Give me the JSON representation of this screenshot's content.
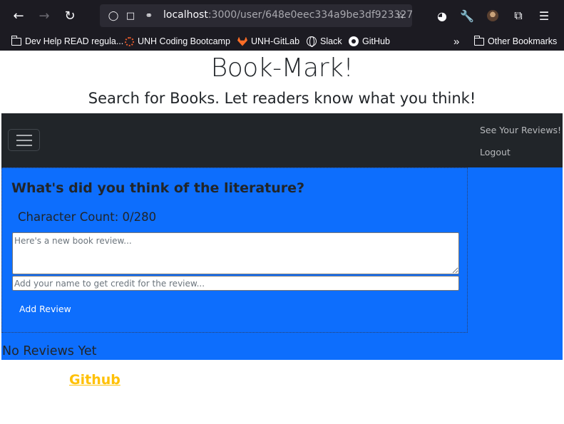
{
  "browser": {
    "url_host": "localhost",
    "url_path": ":3000/user/648e0eec334a9be3df923327",
    "bookmarks": [
      {
        "label": "Dev Help READ regula..."
      },
      {
        "label": "UNH Coding Bootcamp"
      },
      {
        "label": "UNH-GitLab"
      },
      {
        "label": "Slack"
      },
      {
        "label": "GitHub"
      }
    ],
    "overflow_glyph": "»",
    "other_bookmarks": "Other Bookmarks"
  },
  "page": {
    "title": "Book-Mark!",
    "subtitle": "Search for Books. Let readers know what you think!"
  },
  "navbar": {
    "links": [
      {
        "label": "See Your Reviews!"
      },
      {
        "label": "Logout"
      }
    ]
  },
  "review_form": {
    "heading": "What's did you think of the literature?",
    "char_count": "Character Count: 0/280",
    "review_placeholder": "Here's a new book review...",
    "name_placeholder": "Add your name to get credit for the review...",
    "submit_label": "Add Review"
  },
  "reviews": {
    "empty_text": "No Reviews Yet"
  },
  "footer": {
    "link_label": "Github"
  },
  "colors": {
    "primary_blue": "#0d6efd",
    "navbar_dark": "#212529",
    "footer_link": "#ffc107",
    "browser_chrome": "#1c1b22"
  }
}
